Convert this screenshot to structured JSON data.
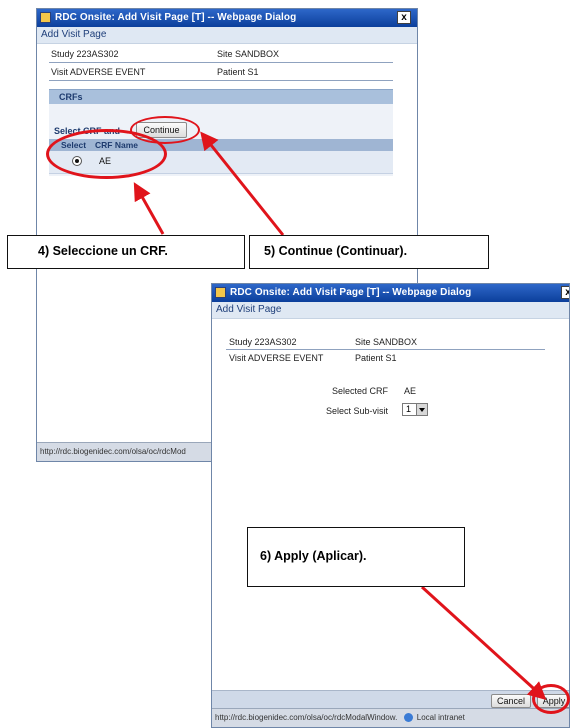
{
  "window1": {
    "title": "RDC Onsite: Add Visit Page [T] -- Webpage Dialog",
    "close_glyph": "x",
    "page_header": "Add Visit Page",
    "study": "Study 223AS302",
    "site": "Site SANDBOX",
    "visit": "Visit ADVERSE EVENT",
    "patient": "Patient S1",
    "crfs_section": "CRFs",
    "select_crf_and": "Select CRF and",
    "continue_button": "Continue",
    "table_headers": [
      "Select",
      "CRF Name"
    ],
    "crf_row": {
      "crf": "AE"
    },
    "status_url": "http://rdc.biogenidec.com/olsa/oc/rdcMod"
  },
  "window2": {
    "title": "RDC Onsite: Add Visit Page [T] -- Webpage Dialog",
    "close_glyph": "x",
    "page_header": "Add Visit Page",
    "study": "Study 223AS302",
    "site": "Site SANDBOX",
    "visit": "Visit ADVERSE EVENT",
    "patient": "Patient S1",
    "selected_crf_label": "Selected CRF",
    "selected_crf_value": "AE",
    "select_subvisit_label": "Select Sub-visit",
    "subvisit_value": "1",
    "cancel_button": "Cancel",
    "apply_button": "Apply",
    "status_url": "http://rdc.biogenidec.com/olsa/oc/rdcModalWindow.",
    "status_zone": "Local intranet"
  },
  "callouts": {
    "step4": "4) Seleccione un CRF.",
    "step5": "5) Continue (Continuar).",
    "step6": "6) Apply (Aplicar)."
  },
  "colors": {
    "annotation_red": "#e0141b",
    "titlebar_blue": "#1f56b8"
  }
}
